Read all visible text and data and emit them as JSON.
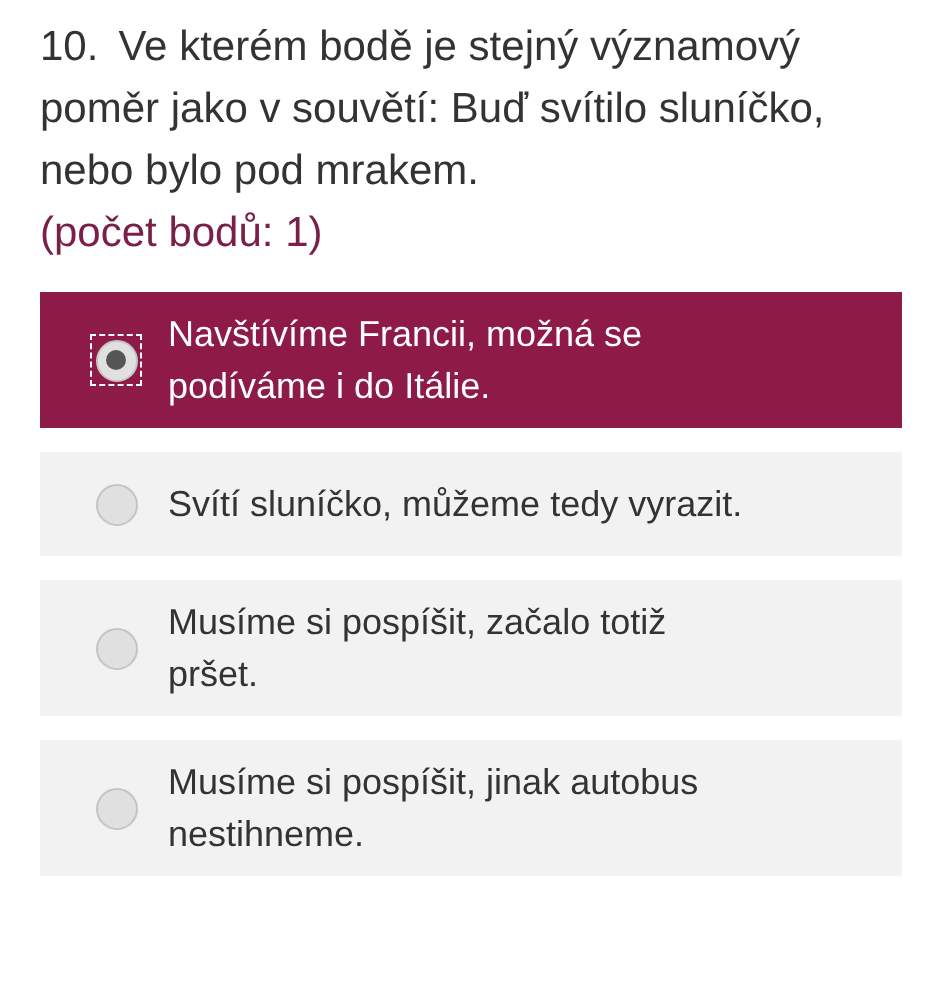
{
  "question": {
    "number": "10.",
    "text": "Ve kterém bodě je stejný významový poměr jako v souvětí: Buď svítilo sluníčko, nebo bylo pod mrakem.",
    "points": "(počet bodů: 1)"
  },
  "options": [
    {
      "label": "Navštívíme Francii, možná se podíváme i do Itálie.",
      "selected": true
    },
    {
      "label": "Svítí sluníčko, můžeme tedy vyrazit.",
      "selected": false
    },
    {
      "label": "Musíme si pospíšit, začalo totiž pršet.",
      "selected": false
    },
    {
      "label": "Musíme si pospíšit, jinak autobus nestihneme.",
      "selected": false
    }
  ]
}
